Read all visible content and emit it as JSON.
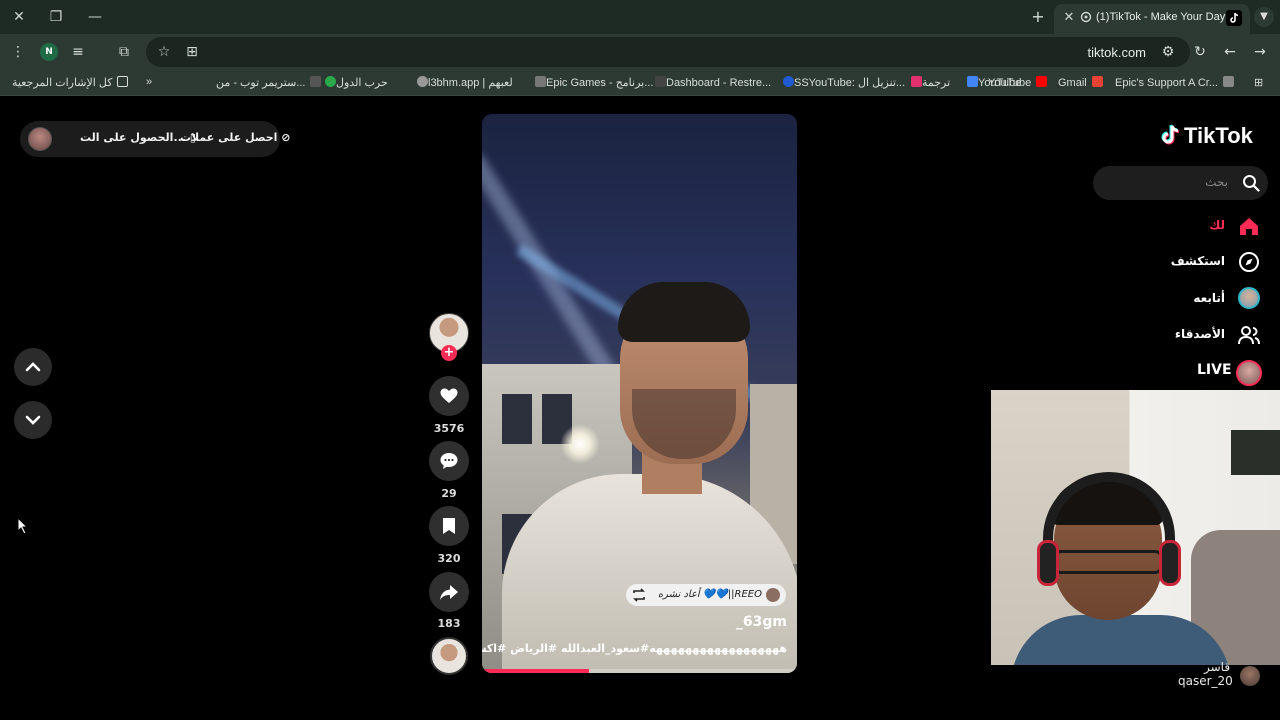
{
  "browser": {
    "tab_title": "(1)TikTok - Make Your Day",
    "url": "tiktok.com",
    "profile_initial": "N",
    "bookmarks": [
      {
        "label": "كل الإشارات المرجعية",
        "color": "#d9dedb"
      },
      {
        "label": "ستريمر توب - من...",
        "color": "#555"
      },
      {
        "label": "حرب الدول",
        "color": "#2aa84a"
      },
      {
        "label": "l3bhm.app | لعبهم",
        "color": "#999"
      },
      {
        "label": "Epic Games - برنامج...",
        "color": "#333"
      },
      {
        "label": "Dashboard - Restre...",
        "color": "#1f5bd1"
      },
      {
        "label": "SSYouTube: تنزيل ال...",
        "color": "#e0306e"
      },
      {
        "label": "ترجمة",
        "color": "#4285f4"
      },
      {
        "label": "YouTube",
        "color": "#ff0000"
      },
      {
        "label": "Gmail",
        "color": "#ea4335"
      },
      {
        "label": "Epic's Support A Cr...",
        "color": "#888"
      }
    ]
  },
  "promo": {
    "get_coins": "احصل على عملات",
    "get_app": "الحصول على الت..."
  },
  "video": {
    "repost_text": "أعاد نشره 💙💙||REEO",
    "author": "_63gm",
    "caption": "ههههههههههههههههههه#سعود_العبدالله #الرياض #اكسبلور",
    "progress": 0.34
  },
  "actions": {
    "likes": "3576",
    "comments": "29",
    "saves": "320",
    "shares": "183"
  },
  "sidebar": {
    "logo": "TikTok",
    "search_placeholder": "بحث",
    "items": [
      {
        "label": "لك",
        "icon": "home-icon",
        "active": true
      },
      {
        "label": "استكشف",
        "icon": "compass-icon"
      },
      {
        "label": "أتابعه",
        "icon": "following-avatar-icon"
      },
      {
        "label": "الأصدقاء",
        "icon": "friends-icon"
      },
      {
        "label": "LIVE",
        "icon": "live-icon"
      }
    ]
  },
  "overlay_user": {
    "name": "قاسر",
    "handle": "qaser_20"
  },
  "colors": {
    "accent": "#fe2c55",
    "chrome_bg": "#2c3a33",
    "titlebar_bg": "#1e2a24"
  }
}
